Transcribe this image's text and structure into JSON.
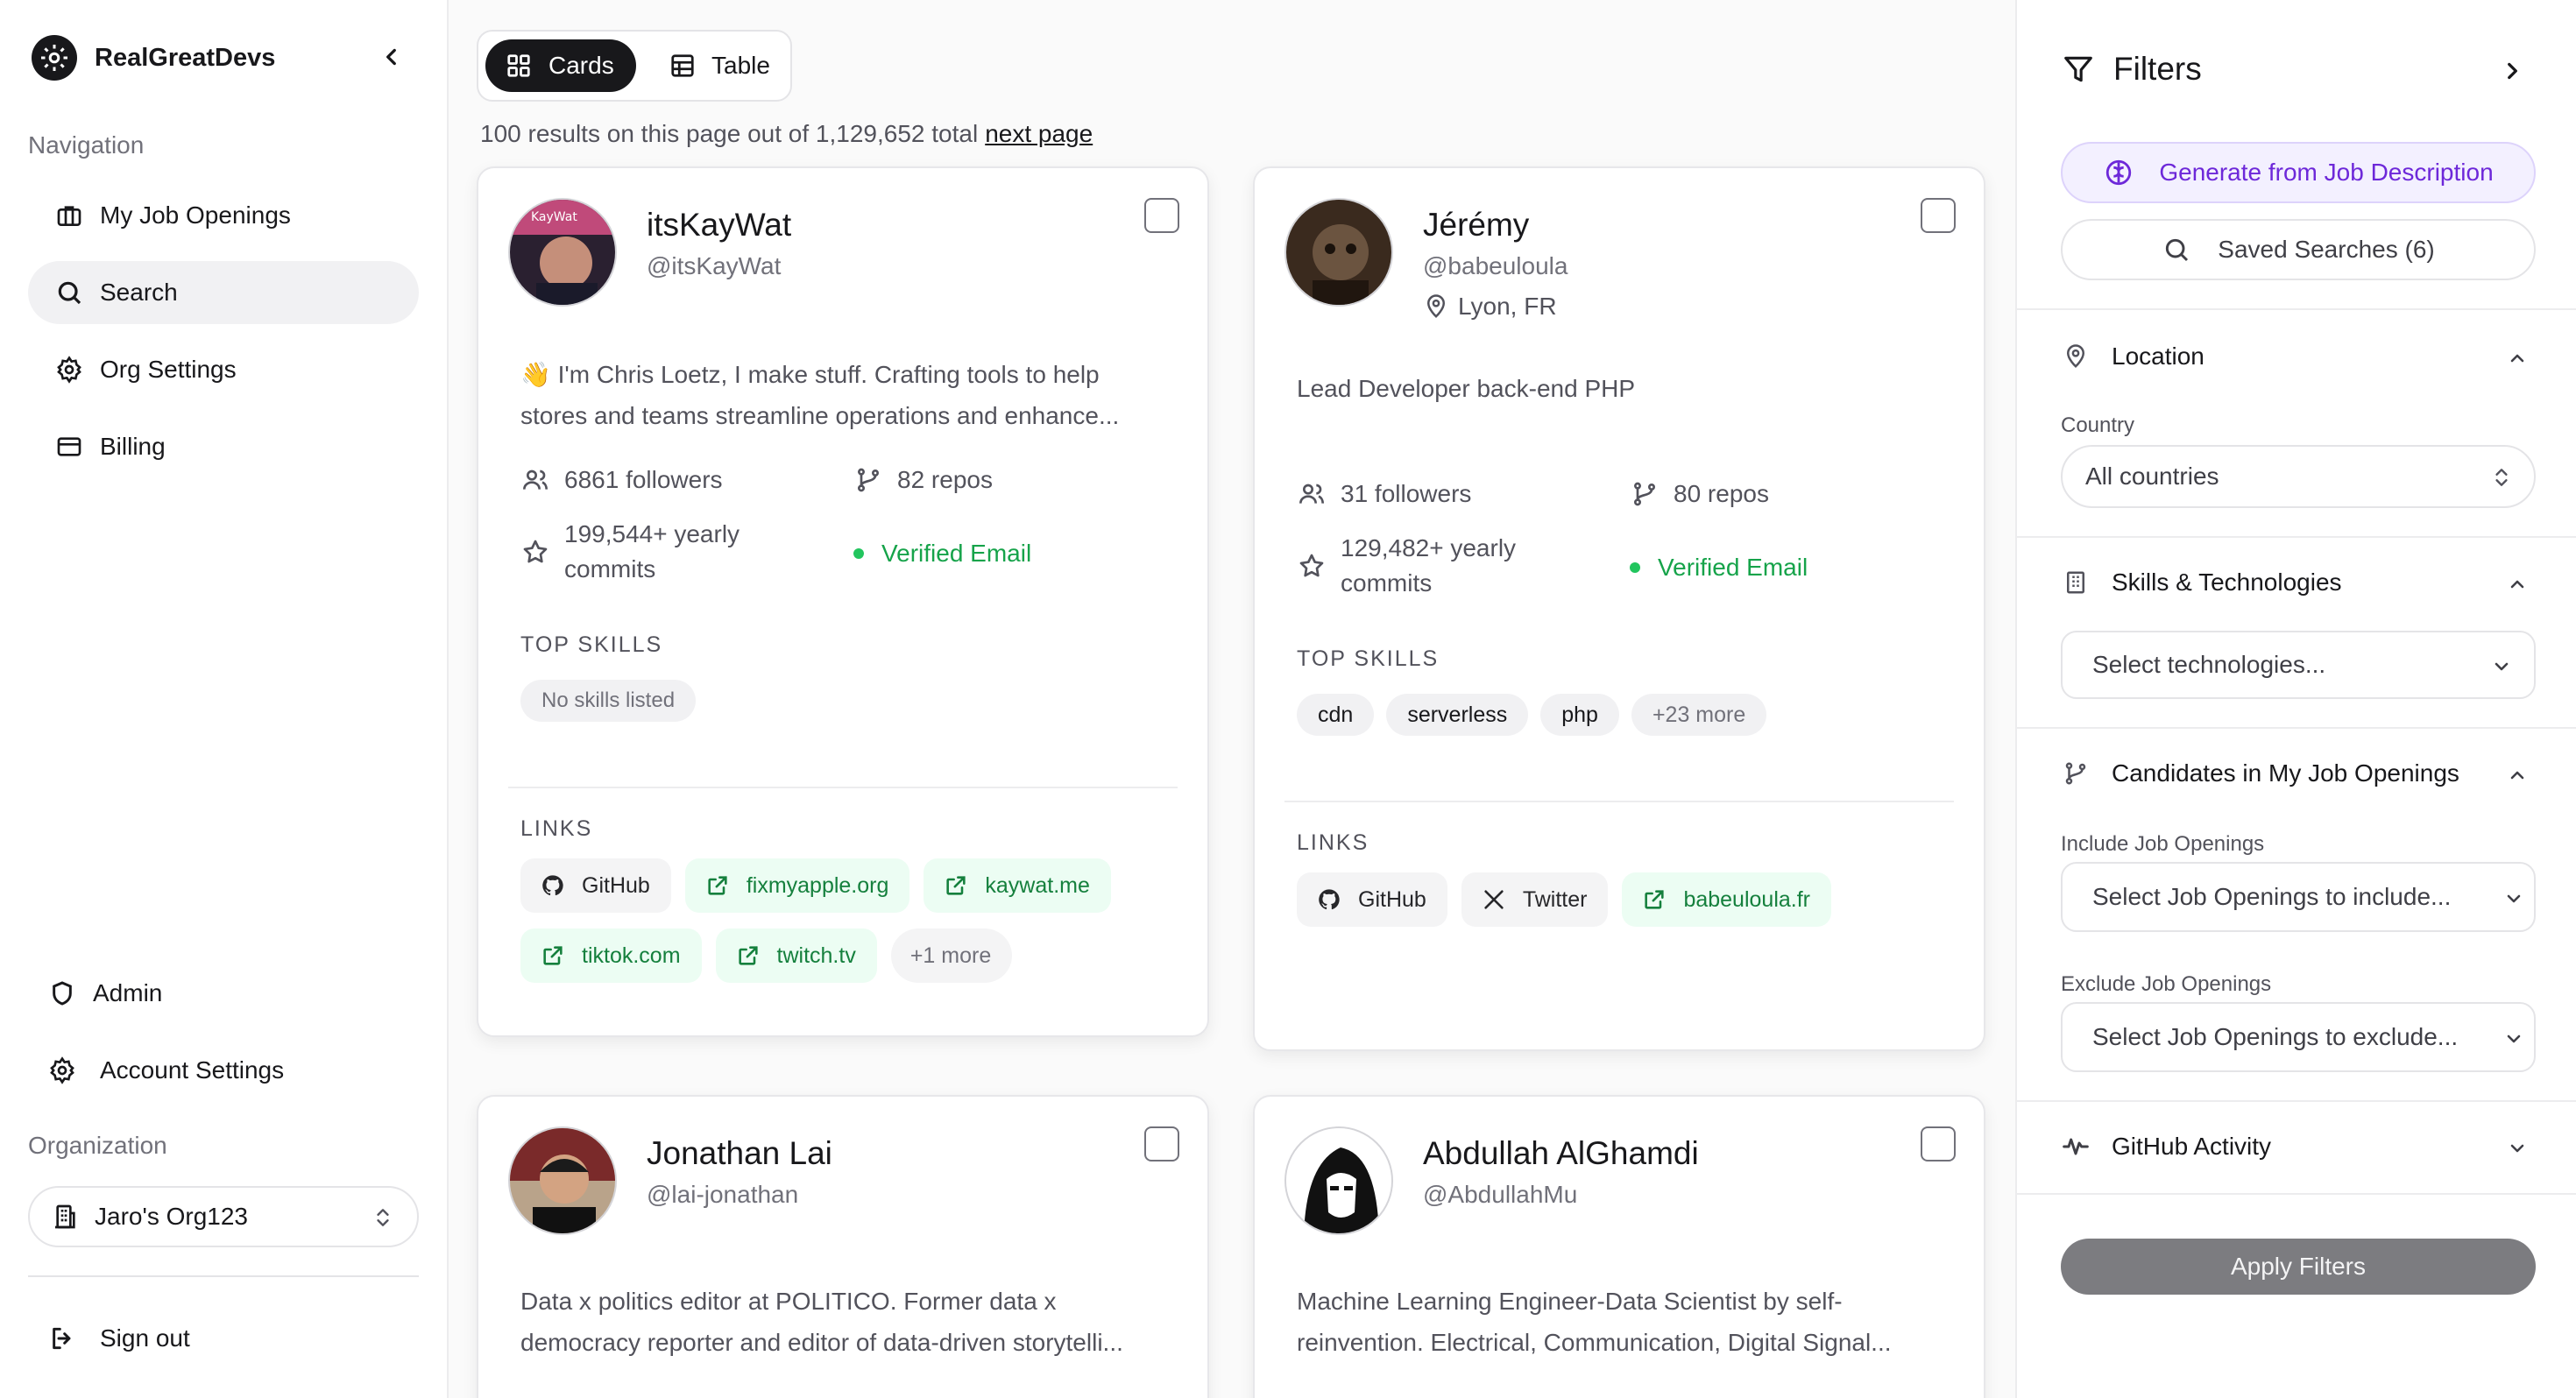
{
  "sidebar": {
    "brand": "RealGreatDevs",
    "nav_label": "Navigation",
    "items": [
      {
        "label": "My Job Openings",
        "icon": "briefcase-icon"
      },
      {
        "label": "Search",
        "icon": "search-icon",
        "active": true
      },
      {
        "label": "Org Settings",
        "icon": "gear-icon"
      },
      {
        "label": "Billing",
        "icon": "credit-card-icon"
      }
    ],
    "bottom_items": [
      {
        "label": "Admin",
        "icon": "shield-icon"
      },
      {
        "label": "Account Settings",
        "icon": "gear-icon"
      }
    ],
    "org_label": "Organization",
    "org_value": "Jaro's Org123",
    "sign_out": "Sign out"
  },
  "main": {
    "view_toggle": {
      "cards": "Cards",
      "table": "Table",
      "active": "cards"
    },
    "results_text": "100 results on this page out of 1,129,652 total",
    "next_page": "next page",
    "cards": [
      {
        "name": "itsKayWat",
        "handle": "@itsKayWat",
        "location": "",
        "bio": "👋 I'm Chris Loetz, I make stuff. Crafting tools to help stores and teams streamline operations and enhance...",
        "followers": "6861 followers",
        "repos": "82 repos",
        "commits": "199,544+ yearly commits",
        "verified": "Verified Email",
        "skills_label": "TOP SKILLS",
        "skills": [
          "No skills listed"
        ],
        "links_label": "LINKS",
        "links": [
          {
            "label": "GitHub",
            "kind": "github"
          },
          {
            "label": "fixmyapple.org",
            "kind": "external"
          },
          {
            "label": "kaywat.me",
            "kind": "external"
          },
          {
            "label": "tiktok.com",
            "kind": "external"
          },
          {
            "label": "twitch.tv",
            "kind": "external"
          },
          {
            "label": "+1 more",
            "kind": "more"
          }
        ]
      },
      {
        "name": "Jérémy",
        "handle": "@babeuloula",
        "location": "Lyon, FR",
        "bio": "Lead Developer back-end PHP",
        "followers": "31 followers",
        "repos": "80 repos",
        "commits": "129,482+ yearly commits",
        "verified": "Verified Email",
        "skills_label": "TOP SKILLS",
        "skills": [
          "cdn",
          "serverless",
          "php",
          "+23 more"
        ],
        "links_label": "LINKS",
        "links": [
          {
            "label": "GitHub",
            "kind": "github"
          },
          {
            "label": "Twitter",
            "kind": "x"
          },
          {
            "label": "babeuloula.fr",
            "kind": "external"
          }
        ]
      },
      {
        "name": "Jonathan Lai",
        "handle": "@lai-jonathan",
        "bio": "Data x politics editor at POLITICO. Former data x democracy reporter and editor of data-driven storytelli..."
      },
      {
        "name": "Abdullah AlGhamdi",
        "handle": "@AbdullahMu",
        "bio": "Machine Learning Engineer-Data Scientist by self-reinvention. Electrical, Communication, Digital Signal..."
      }
    ]
  },
  "filters": {
    "title": "Filters",
    "generate": "Generate from Job Description",
    "saved": "Saved Searches (6)",
    "location": {
      "title": "Location",
      "country_label": "Country",
      "country_value": "All countries"
    },
    "skills": {
      "title": "Skills & Technologies",
      "placeholder": "Select technologies..."
    },
    "candidates": {
      "title": "Candidates in My Job Openings",
      "include_label": "Include Job Openings",
      "include_placeholder": "Select Job Openings to include...",
      "exclude_label": "Exclude Job Openings",
      "exclude_placeholder": "Select Job Openings to exclude..."
    },
    "activity": {
      "title": "GitHub Activity"
    },
    "apply": "Apply Filters"
  },
  "colors": {
    "accent_purple": "#6d28d9",
    "verified_green": "#16a34a",
    "dark": "#18181b"
  }
}
